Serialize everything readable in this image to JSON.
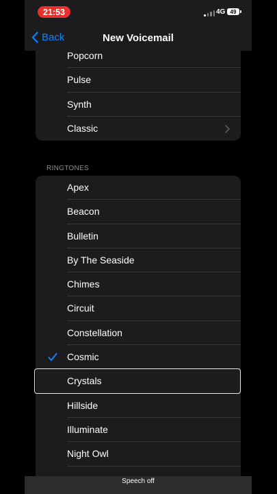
{
  "status_bar": {
    "time": "21:53",
    "network": "4G",
    "battery": "49"
  },
  "nav": {
    "back_label": "Back",
    "title": "New Voicemail"
  },
  "alert_tones": {
    "items": [
      "Popcorn",
      "Pulse",
      "Synth",
      "Classic"
    ]
  },
  "ringtones": {
    "header": "RINGTONES",
    "items": [
      "Apex",
      "Beacon",
      "Bulletin",
      "By The Seaside",
      "Chimes",
      "Circuit",
      "Constellation",
      "Cosmic",
      "Crystals",
      "Hillside",
      "Illuminate",
      "Night Owl"
    ],
    "selected": "Cosmic",
    "focused": "Crystals"
  },
  "caption": "Speech off",
  "colors": {
    "accent": "#0a84ff",
    "focus": "#e8e8e8",
    "status_time": "#e5322d"
  },
  "icons": {
    "back": "chevron-left-icon",
    "classic": "chevron-right-icon",
    "selected": "checkmark-icon"
  }
}
